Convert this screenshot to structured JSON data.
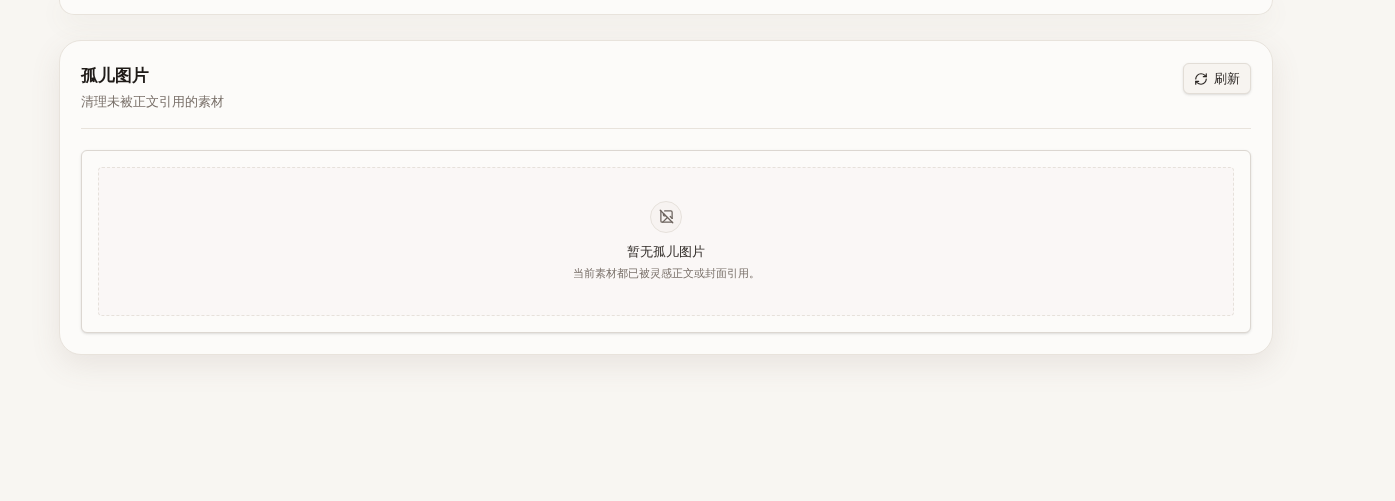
{
  "card": {
    "title": "孤儿图片",
    "subtitle": "清理未被正文引用的素材",
    "refresh_button": "刷新"
  },
  "empty_state": {
    "title": "暂无孤儿图片",
    "message": "当前素材都已被灵感正文或封面引用。"
  }
}
